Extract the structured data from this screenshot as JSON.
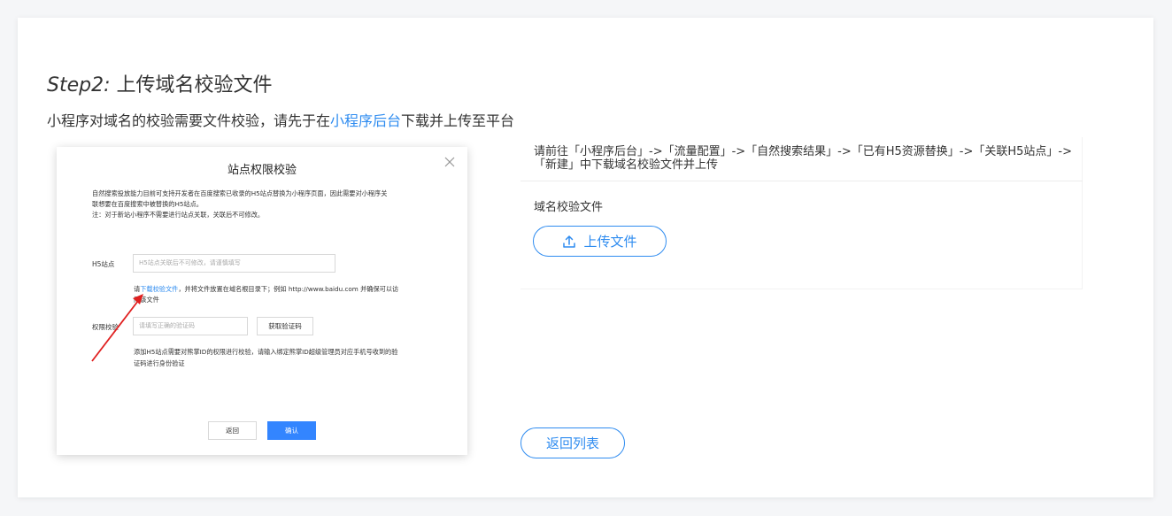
{
  "step": {
    "prefix": "Step2:",
    "title": " 上传域名校验文件"
  },
  "description": {
    "before": "小程序对域名的校验需要文件校验，请先于在",
    "link": "小程序后台",
    "after": "下载并上传至平台"
  },
  "screenshot": {
    "title": "站点权限校验",
    "intro_line1": "自然搜索投放能力目前可支持开发者在百度搜索已收录的H5站点替换为小程序页面，因此需要对小程序关",
    "intro_line2": "联想要在百度搜索中被替换的H5站点。",
    "intro_line3": "注：对于新站小程序不需要进行站点关联，关联后不可修改。",
    "h5_label": "H5站点",
    "h5_placeholder": "H5站点关联后不可修改，请谨慎填写",
    "hint_before": "请",
    "hint_link": "下载校验文件",
    "hint_after": "，并将文件放置在域名根目录下；例如 http://www.baidu.com 并确保可以访",
    "hint_line2": "问该文件",
    "perm_label": "权限校验",
    "code_placeholder": "请填写正确的验证码",
    "get_code": "获取验证码",
    "note_line1": "添加H5站点需要对熊掌ID的权限进行校验，请输入绑定熊掌ID超级管理员对应手机号收到的验",
    "note_line2": "证码进行身份验证",
    "cancel": "返回",
    "confirm": "确认"
  },
  "instruction": "请前往「小程序后台」->「流量配置」->「自然搜索结果」->「已有H5资源替换」->「关联H5站点」->「新建」中下载域名校验文件并上传",
  "field_label": "域名校验文件",
  "upload_label": "上传文件",
  "back_label": "返回列表",
  "colors": {
    "accent": "#2f8cf0",
    "arrow": "#e02020",
    "primary_button": "#3385ff"
  }
}
